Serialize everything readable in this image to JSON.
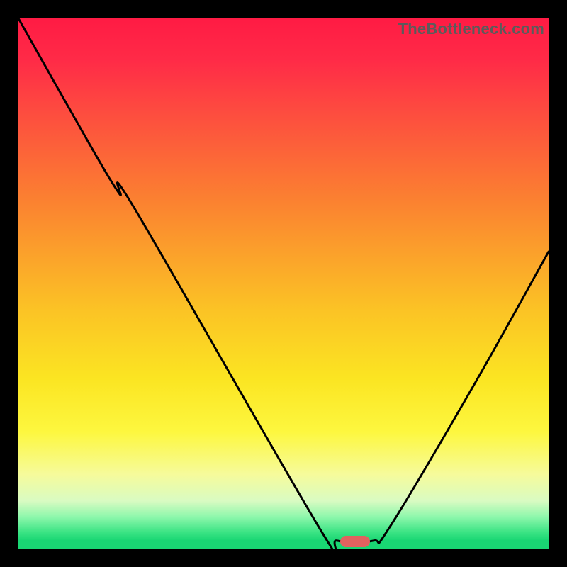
{
  "watermark": "TheBottleneck.com",
  "marker": {
    "x_frac": 0.635,
    "y_frac": 0.986
  },
  "chart_data": {
    "type": "line",
    "title": "",
    "xlabel": "",
    "ylabel": "",
    "xlim": [
      0,
      1
    ],
    "ylim": [
      0,
      1
    ],
    "series": [
      {
        "name": "curve",
        "points": [
          {
            "x": 0.0,
            "y": 1.0
          },
          {
            "x": 0.13,
            "y": 0.77
          },
          {
            "x": 0.19,
            "y": 0.67
          },
          {
            "x": 0.22,
            "y": 0.64
          },
          {
            "x": 0.57,
            "y": 0.035
          },
          {
            "x": 0.6,
            "y": 0.015
          },
          {
            "x": 0.67,
            "y": 0.015
          },
          {
            "x": 0.7,
            "y": 0.04
          },
          {
            "x": 0.86,
            "y": 0.31
          },
          {
            "x": 1.0,
            "y": 0.56
          }
        ]
      }
    ],
    "grid": false,
    "legend": false
  }
}
